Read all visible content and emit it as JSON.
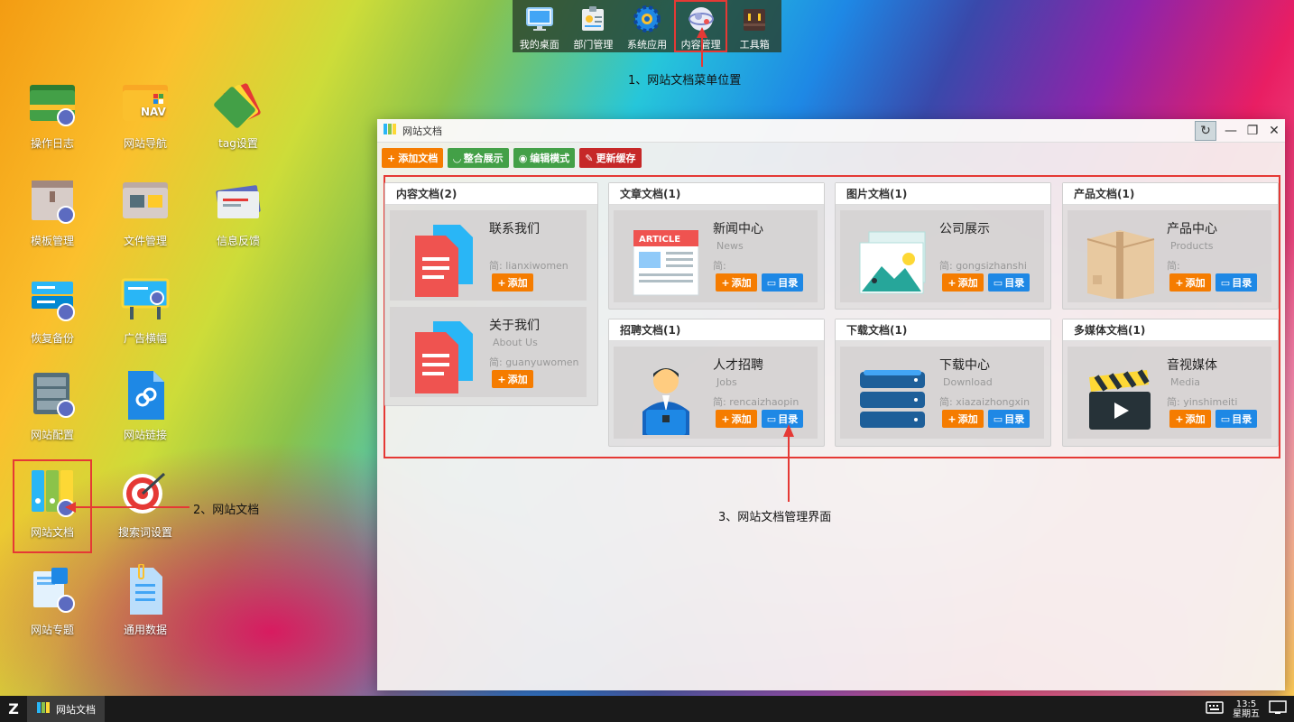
{
  "dock": {
    "items": [
      {
        "label": "我的桌面",
        "icon": "monitor-icon"
      },
      {
        "label": "部门管理",
        "icon": "id-card-icon"
      },
      {
        "label": "系统应用",
        "icon": "gear-icon"
      },
      {
        "label": "内容管理",
        "icon": "globe-icon"
      },
      {
        "label": "工具箱",
        "icon": "toolbox-icon"
      }
    ]
  },
  "annotations": {
    "a1": "1、网站文档菜单位置",
    "a2": "2、网站文档",
    "a3": "3、网站文档管理界面"
  },
  "desktop": {
    "icons": [
      {
        "label": "操作日志"
      },
      {
        "label": "网站导航",
        "badge": "NAV"
      },
      {
        "label": "tag设置"
      },
      {
        "label": "模板管理"
      },
      {
        "label": "文件管理"
      },
      {
        "label": "信息反馈"
      },
      {
        "label": "恢复备份"
      },
      {
        "label": "广告横幅"
      },
      {
        "label": "网站配置"
      },
      {
        "label": "网站链接"
      },
      {
        "label": "网站文档"
      },
      {
        "label": "搜索词设置"
      },
      {
        "label": "网站专题"
      },
      {
        "label": "通用数据"
      }
    ]
  },
  "window": {
    "title": "网站文档",
    "toolbar": {
      "add_doc": "添加文档",
      "merge_display": "整合展示",
      "edit_mode": "编辑模式",
      "update_cache": "更新缓存"
    },
    "panels": {
      "content": {
        "title": "内容文档(2)",
        "cards": [
          {
            "title": "联系我们",
            "sub": "",
            "meta": "简: lianxiwomen",
            "add": "添加"
          },
          {
            "title": "关于我们",
            "sub": "About Us",
            "meta": "简: guanyuwomen",
            "add": "添加"
          }
        ]
      },
      "article": {
        "title": "文章文档(1)",
        "card": {
          "title": "新闻中心",
          "sub": "News",
          "meta": "简:",
          "add": "添加",
          "dir": "目录",
          "art": "ARTICLE"
        }
      },
      "image": {
        "title": "图片文档(1)",
        "card": {
          "title": "公司展示",
          "sub": "",
          "meta": "简: gongsizhanshi",
          "add": "添加",
          "dir": "目录"
        }
      },
      "product": {
        "title": "产品文档(1)",
        "card": {
          "title": "产品中心",
          "sub": "Products",
          "meta": "简:",
          "add": "添加",
          "dir": "目录"
        }
      },
      "recruit": {
        "title": "招聘文档(1)",
        "card": {
          "title": "人才招聘",
          "sub": "Jobs",
          "meta": "简: rencaizhaopin",
          "add": "添加",
          "dir": "目录"
        }
      },
      "download": {
        "title": "下载文档(1)",
        "card": {
          "title": "下载中心",
          "sub": "Download",
          "meta": "简: xiazaizhongxin",
          "add": "添加",
          "dir": "目录"
        }
      },
      "media": {
        "title": "多媒体文档(1)",
        "card": {
          "title": "音视媒体",
          "sub": "Media",
          "meta": "简: yinshimeiti",
          "add": "添加",
          "dir": "目录"
        }
      }
    }
  },
  "taskbar": {
    "start": "Z",
    "task_label": "网站文档",
    "time": "13:5",
    "weekday": "星期五"
  },
  "colors": {
    "orange": "#f57c00",
    "blue": "#1e88e5",
    "green": "#43a047",
    "red": "#c62828",
    "highlight": "#e53935"
  }
}
